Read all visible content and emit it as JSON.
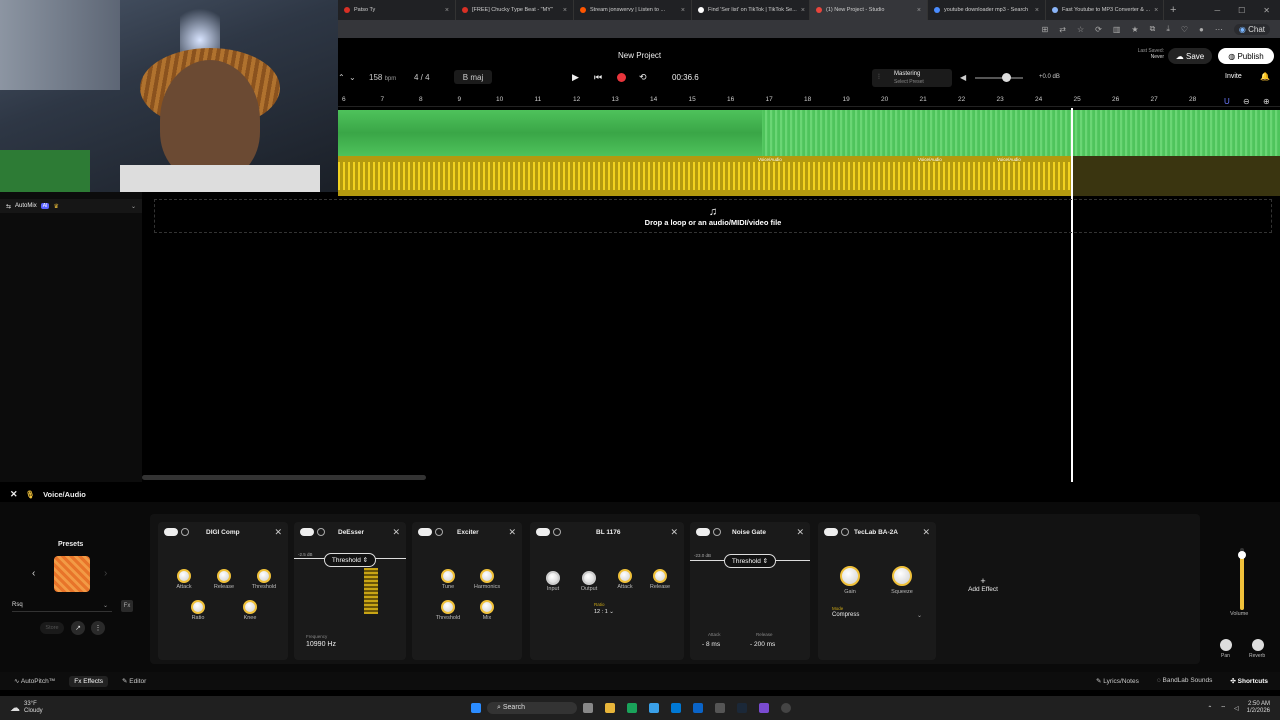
{
  "browser": {
    "tabs": [
      {
        "label": "Patso Ty",
        "color": "#d93025"
      },
      {
        "label": "[FREE] Chucky Type Beat - \"MY\"",
        "color": "#d93025"
      },
      {
        "label": "Stream jonswervy | Listen to ...",
        "color": "#ff5500"
      },
      {
        "label": "Find 'Ser list' on TikTok | TikTok Se...",
        "color": "#ffffff"
      },
      {
        "label": "(1) New Project - Studio",
        "color": "#e8453c",
        "active": true
      },
      {
        "label": "youtube downloader mp3 - Search",
        "color": "#4a8cff"
      },
      {
        "label": "Fast Youtube to MP3 Converter & ...",
        "color": "#8ab4f8"
      }
    ],
    "chat_label": "Chat"
  },
  "studio": {
    "project_title": "New Project",
    "bpm": "158",
    "bpm_unit": "bpm",
    "time_sig": "4 / 4",
    "key": "B maj",
    "time": "00:36.6",
    "mastering_label": "Mastering",
    "mastering_sub": "Select Preset",
    "master_db": "+0.0 dB",
    "last_saved_label": "Last Saved:",
    "last_saved_value": "Never",
    "save_label": "Save",
    "publish_label": "Publish",
    "invite_label": "Invite"
  },
  "ruler": [
    "6",
    "7",
    "8",
    "9",
    "10",
    "11",
    "12",
    "13",
    "14",
    "15",
    "16",
    "17",
    "18",
    "19",
    "20",
    "21",
    "22",
    "23",
    "24",
    "25",
    "26",
    "27",
    "28"
  ],
  "tracks": {
    "automix_label": "AutoMix",
    "ai_badge": "AI",
    "clip_labels": [
      "Voice/Audio",
      "Voice/Audio",
      "Voice/Audio"
    ],
    "drop_text": "Drop a loop or an audio/MIDI/video file"
  },
  "effects": {
    "track_name": "Voice/Audio",
    "presets_label": "Presets",
    "preset_name": "Rsq",
    "store_label": "Store",
    "add_effect_label": "Add Effect",
    "plugins": [
      {
        "name": "DIGI Comp",
        "knobs": [
          "Attack",
          "Release",
          "Threshold",
          "Ratio",
          "Knee"
        ]
      },
      {
        "name": "DeEsser",
        "threshold_label": "Threshold",
        "db": "-2.5 dB",
        "freq_label": "Frequency",
        "freq_value": "10990 Hz"
      },
      {
        "name": "Exciter",
        "knobs": [
          "Tune",
          "Harmonics",
          "Threshold",
          "Mix"
        ]
      },
      {
        "name": "BL 1176",
        "knobs": [
          "Input",
          "Output",
          "Attack",
          "Release"
        ],
        "ratio_label": "Ratio",
        "ratio_value": "12 : 1"
      },
      {
        "name": "Noise Gate",
        "threshold_label": "Threshold",
        "db": "-23.0 dB",
        "attack_label": "Attack",
        "attack_value": "8 ms",
        "release_label": "Release",
        "release_value": "200 ms"
      },
      {
        "name": "TecLab BA-2A",
        "knobs": [
          "Gain",
          "Squeeze"
        ],
        "mode_label": "Mode",
        "mode_value": "Compress"
      }
    ],
    "volume_label": "Volume",
    "pan_label": "Pan",
    "reverb_label": "Reverb"
  },
  "bottombar": {
    "autopitch": "AutoPitch™",
    "effects": "Effects",
    "editor": "Editor",
    "lyrics": "Lyrics/Notes",
    "bandlab_sounds": "BandLab Sounds",
    "shortcuts": "Shortcuts"
  },
  "taskbar": {
    "weather_temp": "33°F",
    "weather_cond": "Cloudy",
    "search": "Search",
    "time": "2:50 AM",
    "date": "1/2/2026"
  }
}
